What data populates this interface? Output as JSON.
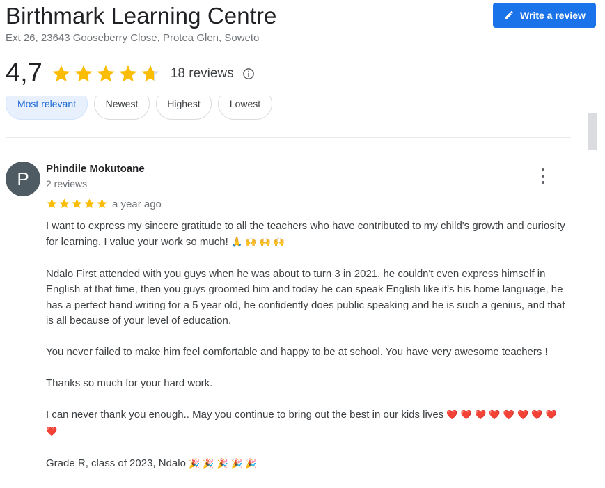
{
  "place": {
    "title": "Birthmark Learning Centre",
    "address": "Ext 26, 23643 Gooseberry Close, Protea Glen, Soweto"
  },
  "write_review": {
    "label": "Write a review",
    "icon": "pencil-icon"
  },
  "rating": {
    "value": "4,7",
    "stars": 4.7,
    "reviews_label": "18 reviews",
    "info_icon": "info-icon",
    "star_color": "#fbbc04"
  },
  "sort_chips": [
    {
      "label": "Most relevant",
      "active": true
    },
    {
      "label": "Newest",
      "active": false
    },
    {
      "label": "Highest",
      "active": false
    },
    {
      "label": "Lowest",
      "active": false
    }
  ],
  "review": {
    "avatar_letter": "P",
    "avatar_color": "#4e5b62",
    "name": "Phindile Mokutoane",
    "meta": "2 reviews",
    "stars": 5,
    "date": "a year ago",
    "paragraphs": [
      {
        "text": "I want to express my sincere gratitude to all the teachers who have contributed to my child's growth and curiosity for learning. I value your work so much! ",
        "emoji": "🙏 🙌 🙌 🙌"
      },
      {
        "text": "Ndalo First attended with you guys when he was about to turn 3 in 2021, he couldn't even express himself in English at that time, then you guys groomed him and today he can speak English like it's his home language, he has a perfect hand writing for a 5 year old, he confidently does public speaking and he is such a genius, and that is all because of your level of education.",
        "emoji": ""
      },
      {
        "text": "You never failed to make him feel comfortable and happy to be at school. You have very  awesome teachers !",
        "emoji": ""
      },
      {
        "text": "Thanks so much for your hard work.",
        "emoji": ""
      },
      {
        "text": "I can never thank you enough.. May you continue to bring out the best in our kids lives ",
        "emoji": "❤️ ❤️ ❤️ ❤️ ❤️ ❤️ ❤️ ❤️ ❤️"
      },
      {
        "text": "Grade R, class of 2023, Ndalo ",
        "emoji": "🎉 🎉 🎉 🎉 🎉"
      }
    ]
  }
}
